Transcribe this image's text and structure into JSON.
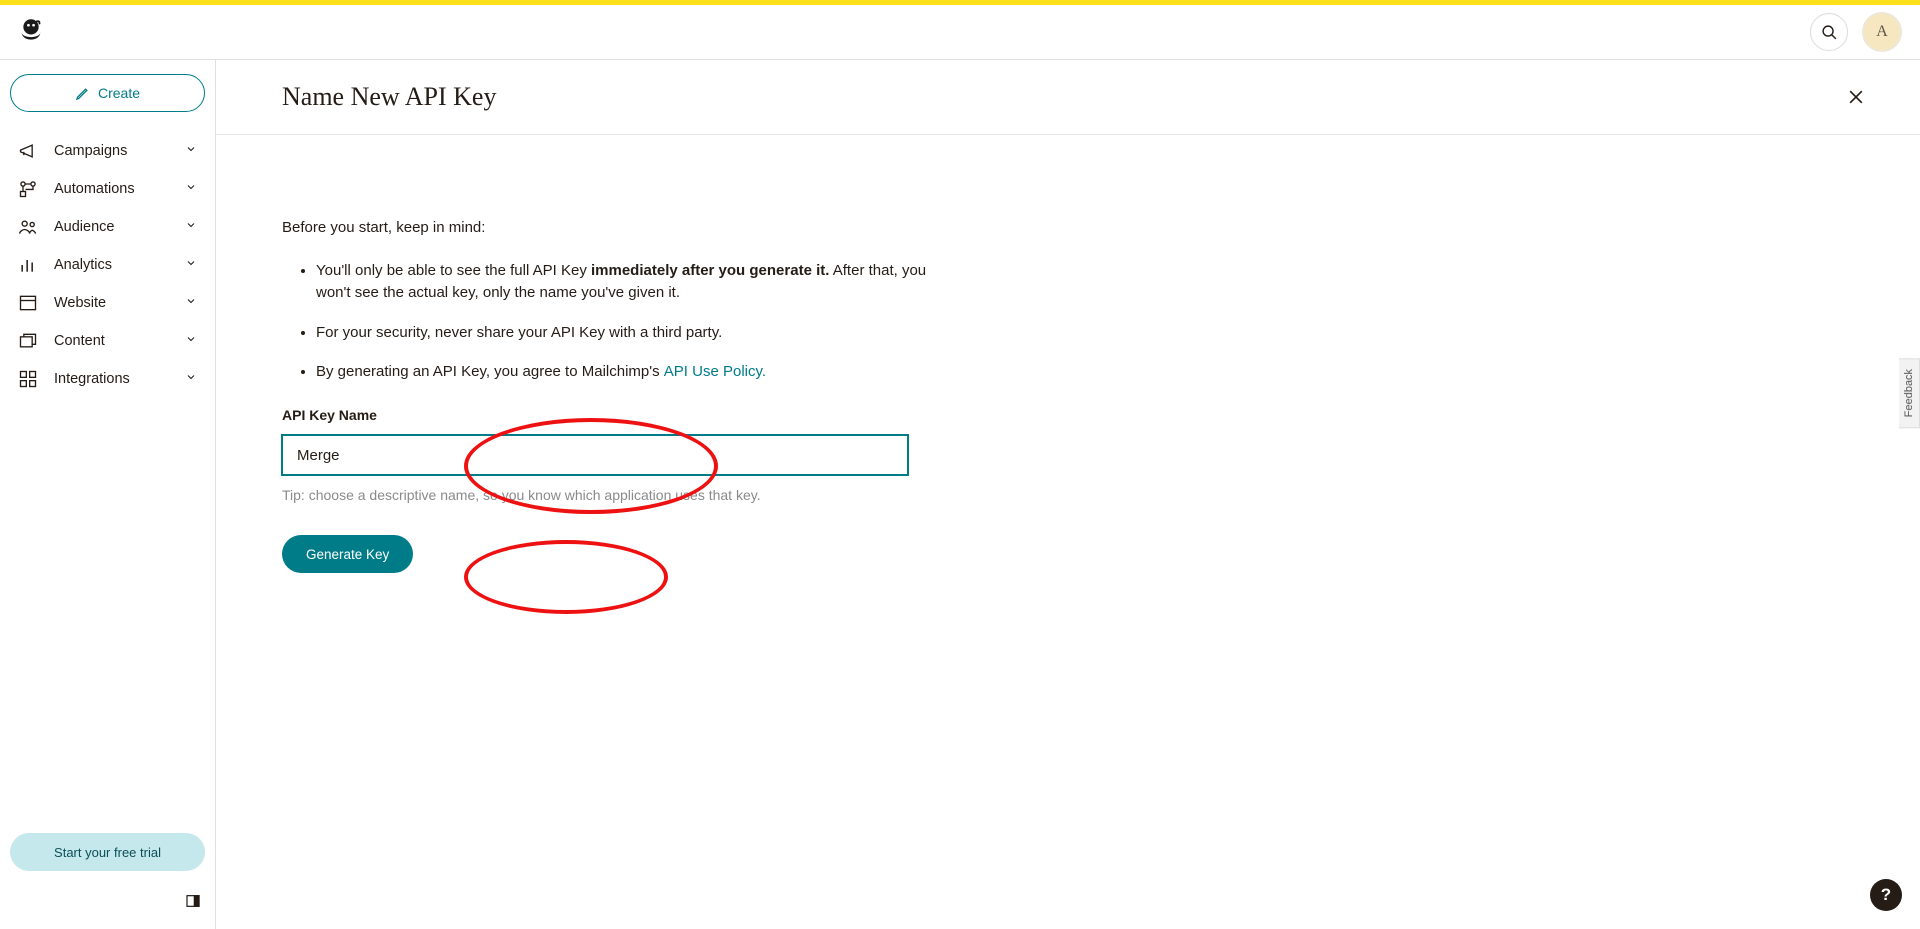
{
  "header": {
    "avatar_initial": "A"
  },
  "sidebar": {
    "create_label": "Create",
    "items": [
      {
        "label": "Campaigns"
      },
      {
        "label": "Automations"
      },
      {
        "label": "Audience"
      },
      {
        "label": "Analytics"
      },
      {
        "label": "Website"
      },
      {
        "label": "Content"
      },
      {
        "label": "Integrations"
      }
    ],
    "trial_label": "Start your free trial"
  },
  "page": {
    "title": "Name New API Key",
    "intro": "Before you start, keep in mind:",
    "bullet1_a": "You'll only be able to see the full API Key ",
    "bullet1_b": "immediately after you generate it.",
    "bullet1_c": " After that, you won't see the actual key, only the name you've given it.",
    "bullet2": "For your security, never share your API Key with a third party.",
    "bullet3_a": "By generating an API Key, you agree to Mailchimp's ",
    "bullet3_link": "API Use Policy.",
    "form_label": "API Key Name",
    "input_value": "Merge",
    "tip": "Tip: choose a descriptive name, so you know which application uses that key.",
    "generate_label": "Generate Key"
  },
  "misc": {
    "feedback": "Feedback",
    "help": "?"
  }
}
